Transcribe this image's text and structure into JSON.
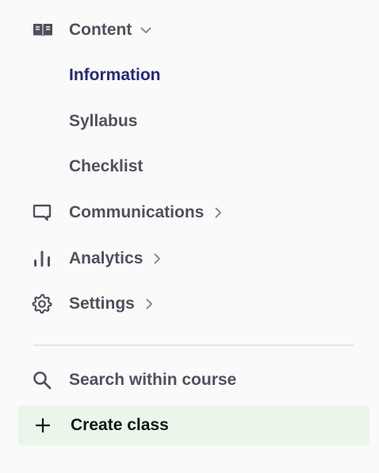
{
  "nav": {
    "content": {
      "label": "Content",
      "icon": "book-icon",
      "expanded": true,
      "subitems": [
        {
          "label": "Information",
          "active": true
        },
        {
          "label": "Syllabus",
          "active": false
        },
        {
          "label": "Checklist",
          "active": false
        }
      ]
    },
    "communications": {
      "label": "Communications",
      "icon": "chat-icon"
    },
    "analytics": {
      "label": "Analytics",
      "icon": "bar-chart-icon"
    },
    "settings": {
      "label": "Settings",
      "icon": "gear-icon"
    }
  },
  "search": {
    "label": "Search within course",
    "icon": "search-icon"
  },
  "create": {
    "label": "Create class",
    "icon": "plus-icon"
  },
  "colors": {
    "text": "#51505e",
    "active": "#272682",
    "create_bg": "#e9f6e9",
    "background": "#fafafa"
  }
}
